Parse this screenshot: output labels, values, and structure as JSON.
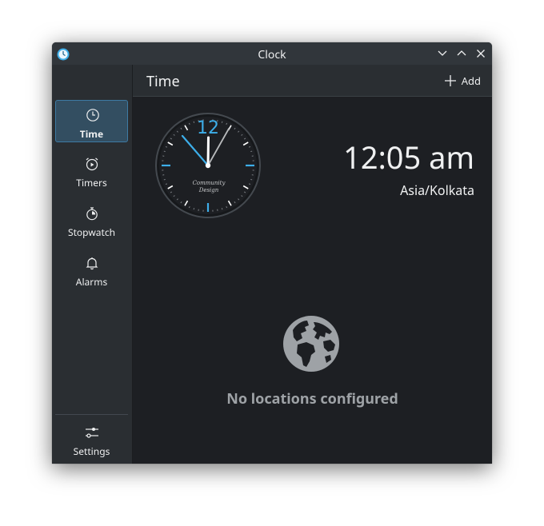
{
  "window": {
    "title": "Clock",
    "app_icon": "clock-app-icon",
    "controls": [
      "minimize-chevron-icon",
      "maximize-chevron-icon",
      "close-x-icon"
    ]
  },
  "sidebar": {
    "items": [
      {
        "id": "time",
        "label": "Time",
        "icon": "clock-icon",
        "active": true
      },
      {
        "id": "timers",
        "label": "Timers",
        "icon": "timer-play-icon",
        "active": false
      },
      {
        "id": "stopwatch",
        "label": "Stopwatch",
        "icon": "stopwatch-icon",
        "active": false
      },
      {
        "id": "alarms",
        "label": "Alarms",
        "icon": "bell-icon",
        "active": false
      }
    ],
    "settings": {
      "label": "Settings",
      "icon": "sliders-icon"
    }
  },
  "header": {
    "title": "Time",
    "add_label": "Add",
    "add_icon": "plus-icon"
  },
  "clock": {
    "face_text_line1": "Community",
    "face_text_line2": "Design",
    "twelve_label": "12",
    "time": "12:05 am",
    "timezone": "Asia/Kolkata"
  },
  "empty_state": {
    "icon": "globe-icon",
    "message": "No locations configured"
  },
  "colors": {
    "accent": "#3daee9",
    "window_bg": "#1d1f23",
    "sidebar_bg": "#2a2e32",
    "titlebar_bg": "#31363b",
    "active_item_bg": "#334e61",
    "text": "#eff0f1",
    "muted_text": "#9ea2a6"
  }
}
